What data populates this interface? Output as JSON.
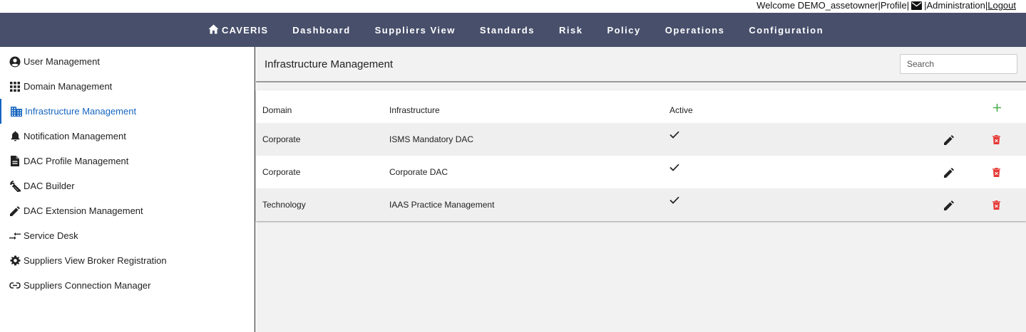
{
  "topbar": {
    "welcome": "Welcome DEMO_assetowner",
    "sep1": " | ",
    "profile": "Profile",
    "sep2": " | ",
    "sep3": " | ",
    "administration": "Administration",
    "sep4": " | ",
    "logout": "Logout"
  },
  "nav": {
    "brand": "CAVERIS",
    "items": [
      "Dashboard",
      "Suppliers View",
      "Standards",
      "Risk",
      "Policy",
      "Operations",
      "Configuration"
    ]
  },
  "sidebar": {
    "items": [
      {
        "label": "User Management",
        "icon": "account-circle-icon"
      },
      {
        "label": "Domain Management",
        "icon": "apps-grid-icon"
      },
      {
        "label": "Infrastructure Management",
        "icon": "building-icon",
        "active": true
      },
      {
        "label": "Notification Management",
        "icon": "bell-icon"
      },
      {
        "label": "DAC Profile Management",
        "icon": "document-icon"
      },
      {
        "label": "DAC Builder",
        "icon": "wrench-icon"
      },
      {
        "label": "DAC Extension Management",
        "icon": "pencil-icon"
      },
      {
        "label": "Service Desk",
        "icon": "swap-arrows-icon"
      },
      {
        "label": "Suppliers View Broker Registration",
        "icon": "gear-icon"
      },
      {
        "label": "Suppliers Connection Manager",
        "icon": "link-icon"
      }
    ]
  },
  "main": {
    "title": "Infrastructure Management",
    "search_placeholder": "Search",
    "columns": [
      "Domain",
      "Infrastructure",
      "Active"
    ],
    "rows": [
      {
        "domain": "Corporate",
        "infrastructure": "ISMS Mandatory DAC",
        "active": true
      },
      {
        "domain": "Corporate",
        "infrastructure": "Corporate DAC",
        "active": true
      },
      {
        "domain": "Technology",
        "infrastructure": "IAAS Practice Management",
        "active": true
      }
    ]
  },
  "colors": {
    "navbar": "#474f6b",
    "active_link": "#1565c0",
    "add": "#4caf50",
    "delete": "#e53935"
  }
}
